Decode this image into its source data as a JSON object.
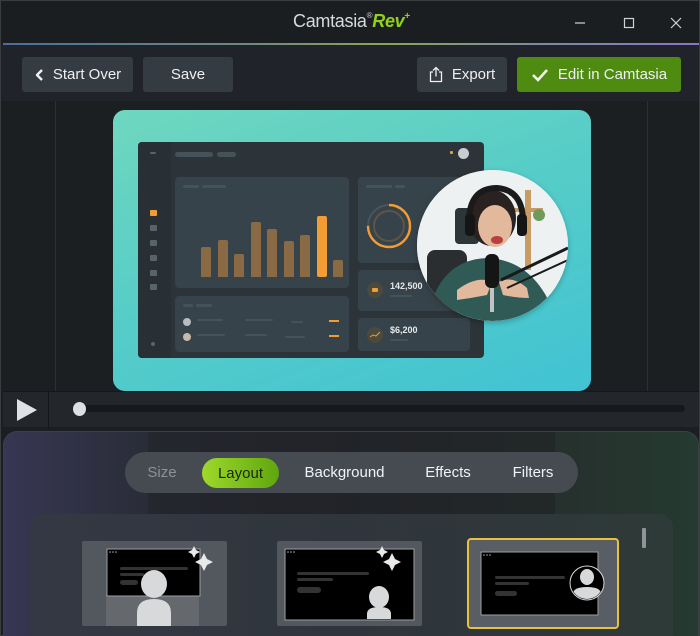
{
  "titlebar": {
    "app_name": "Camtasia",
    "app_suffix": "Rev",
    "reg_mark": "®",
    "plus": "+",
    "controls": [
      "minimize",
      "maximize",
      "close"
    ]
  },
  "toolbar": {
    "start_over_label": "Start Over",
    "save_label": "Save",
    "export_label": "Export",
    "edit_label": "Edit in Camtasia"
  },
  "preview": {
    "dashboard": {
      "stat_1_value": "142,500",
      "stat_2_value": "$6,200",
      "bar_values": [
        0.42,
        0.52,
        0.32,
        0.76,
        0.66,
        0.5,
        0.58,
        0.85,
        0.24
      ],
      "highlight_bar_index": 7,
      "donut_progress": 0.75
    },
    "accent_orange": "#f29c34",
    "background_gradient": [
      "#6fd7bf",
      "#41c3d4"
    ]
  },
  "playback": {
    "play_icon": "play-icon",
    "progress": 0.0
  },
  "panel": {
    "tabs": [
      {
        "label": "Size",
        "state": "disabled"
      },
      {
        "label": "Layout",
        "state": "active"
      },
      {
        "label": "Background",
        "state": "normal"
      },
      {
        "label": "Effects",
        "state": "normal"
      },
      {
        "label": "Filters",
        "state": "normal"
      }
    ],
    "layouts": [
      {
        "name": "Full-frame presenter with AI sparkle",
        "selected": false
      },
      {
        "name": "Corner presenter with AI sparkle",
        "selected": false
      },
      {
        "name": "Circle webcam bubble",
        "selected": true
      }
    ],
    "accent_green": "#8fd11a",
    "selected_border": "#e8c23a"
  }
}
